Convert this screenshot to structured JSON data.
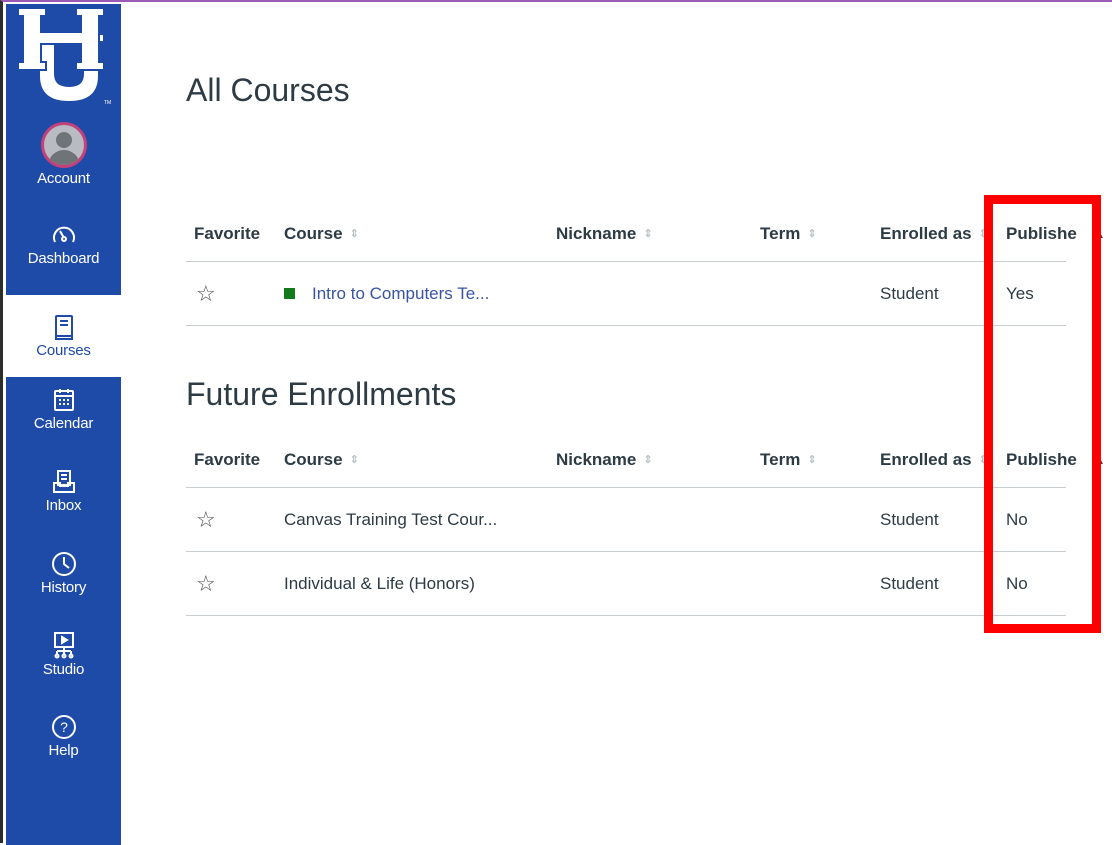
{
  "nav": {
    "items": [
      {
        "label": "Account",
        "icon": "avatar"
      },
      {
        "label": "Dashboard",
        "icon": "dashboard-gauge-icon"
      },
      {
        "label": "Courses",
        "icon": "book-icon"
      },
      {
        "label": "Calendar",
        "icon": "calendar-icon"
      },
      {
        "label": "Inbox",
        "icon": "inbox-icon"
      },
      {
        "label": "History",
        "icon": "clock-icon"
      },
      {
        "label": "Studio",
        "icon": "studio-icon"
      },
      {
        "label": "Help",
        "icon": "help-icon"
      }
    ],
    "active": "Courses",
    "bg_color": "#1f4ba8"
  },
  "page": {
    "title": "All Courses",
    "future_title": "Future Enrollments"
  },
  "table": {
    "headers": {
      "favorite": "Favorite",
      "course": "Course",
      "nickname": "Nickname",
      "term": "Term",
      "enrolled_as": "Enrolled as",
      "published": "Publishe"
    },
    "sort_glyph": "⇕"
  },
  "all_courses": [
    {
      "course": "Intro to Computers Te...",
      "nickname": "",
      "term": "",
      "enrolled_as": "Student",
      "published": "Yes",
      "color": "#127a1b"
    }
  ],
  "future_enrollments": [
    {
      "course": "Canvas Training Test Cour...",
      "nickname": "",
      "term": "",
      "enrolled_as": "Student",
      "published": "No"
    },
    {
      "course": "Individual & Life (Honors)",
      "nickname": "",
      "term": "",
      "enrolled_as": "Student",
      "published": "No"
    }
  ],
  "annotation": {
    "color": "#ff0000"
  }
}
